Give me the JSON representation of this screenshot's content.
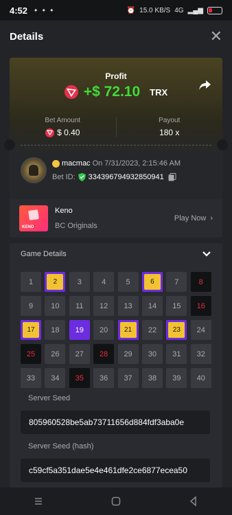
{
  "status_bar": {
    "time": "4:52",
    "network_speed": "15.0 KB/S",
    "signal": "4G",
    "battery": "7"
  },
  "header": {
    "title": "Details"
  },
  "ticket": {
    "profit_label": "Profit",
    "profit_amount": "+$ 72.10",
    "currency": "TRX",
    "bet_amount_label": "Bet Amount",
    "bet_amount": "$ 0.40",
    "payout_label": "Payout",
    "payout": "180 x"
  },
  "player": {
    "name": "macmac",
    "timestamp": "On 7/31/2023, 2:15:46 AM",
    "bet_id_label": "Bet ID:",
    "bet_id": "334396794932850941"
  },
  "game": {
    "name": "Keno",
    "provider": "BC Originals",
    "thumb_text": "KENO",
    "play_now_label": "Play Now"
  },
  "game_details": {
    "title": "Game Details",
    "cells": [
      {
        "n": "1",
        "s": "none"
      },
      {
        "n": "2",
        "s": "hit"
      },
      {
        "n": "3",
        "s": "none"
      },
      {
        "n": "4",
        "s": "none"
      },
      {
        "n": "5",
        "s": "none"
      },
      {
        "n": "6",
        "s": "hit"
      },
      {
        "n": "7",
        "s": "none"
      },
      {
        "n": "8",
        "s": "miss"
      },
      {
        "n": "9",
        "s": "none"
      },
      {
        "n": "10",
        "s": "none"
      },
      {
        "n": "11",
        "s": "none"
      },
      {
        "n": "12",
        "s": "none"
      },
      {
        "n": "13",
        "s": "none"
      },
      {
        "n": "14",
        "s": "none"
      },
      {
        "n": "15",
        "s": "none"
      },
      {
        "n": "16",
        "s": "miss"
      },
      {
        "n": "17",
        "s": "hit"
      },
      {
        "n": "18",
        "s": "none"
      },
      {
        "n": "19",
        "s": "pick"
      },
      {
        "n": "20",
        "s": "none"
      },
      {
        "n": "21",
        "s": "hit"
      },
      {
        "n": "22",
        "s": "none"
      },
      {
        "n": "23",
        "s": "hit"
      },
      {
        "n": "24",
        "s": "none"
      },
      {
        "n": "25",
        "s": "miss"
      },
      {
        "n": "26",
        "s": "none"
      },
      {
        "n": "27",
        "s": "none"
      },
      {
        "n": "28",
        "s": "miss"
      },
      {
        "n": "29",
        "s": "none"
      },
      {
        "n": "30",
        "s": "none"
      },
      {
        "n": "31",
        "s": "none"
      },
      {
        "n": "32",
        "s": "none"
      },
      {
        "n": "33",
        "s": "none"
      },
      {
        "n": "34",
        "s": "none"
      },
      {
        "n": "35",
        "s": "miss"
      },
      {
        "n": "36",
        "s": "none"
      },
      {
        "n": "37",
        "s": "none"
      },
      {
        "n": "38",
        "s": "none"
      },
      {
        "n": "39",
        "s": "none"
      },
      {
        "n": "40",
        "s": "none"
      }
    ],
    "server_seed_label": "Server Seed",
    "server_seed": "805960528be5ab73711656d884fdf3aba0e",
    "server_seed_hash_label": "Server Seed (hash)",
    "server_seed_hash": "c59cf5a351dae5e4e461dfe2ce6877ecea50"
  },
  "colors": {
    "profit_green": "#3fdc3a",
    "hit_purple": "#6c2ce0",
    "hit_gold": "#f2c232",
    "miss_red": "#e0303a",
    "trx_red": "#e8304b"
  }
}
